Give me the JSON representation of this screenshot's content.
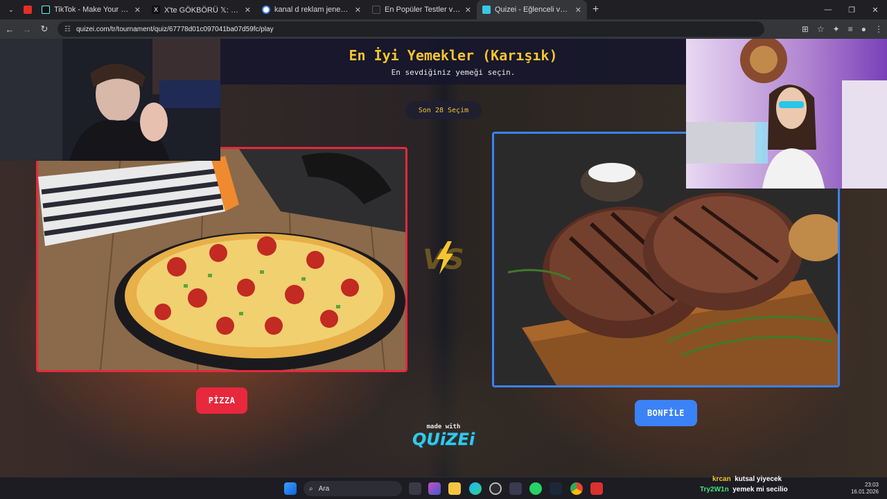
{
  "browser": {
    "tabs": [
      {
        "title": "",
        "favicon_color": "#e52d27"
      },
      {
        "title": "TikTok - Make Your Day",
        "favicon_color": "#111111"
      },
      {
        "title": "X'te GÖKBÖRÜ 𝕏: \"TÜRKİYE TÜ",
        "favicon_color": "#111111"
      },
      {
        "title": "kanal d reklam jeneriği - Google",
        "favicon_color": "#4285f4"
      },
      {
        "title": "En Popüler Testler ve Eğlenceli",
        "favicon_color": "#222222"
      },
      {
        "title": "Quizei - Eğlenceli ve etkileşimli",
        "favicon_color": "#38c7e8"
      }
    ],
    "url": "quizei.com/tr/tournament/quiz/67778d01c097041ba07d59fc/play"
  },
  "quiz": {
    "title": "En İyi Yemekler (Karışık)",
    "subtitle": "En sevdiğiniz yemeği seçin.",
    "round_label": "Son 28 Seçim",
    "left_choice": "PİZZA",
    "right_choice": "BONFİLE",
    "made_with": "made with",
    "brand": "QUiZEi",
    "left_color": "#e7283d",
    "right_color": "#3b82f6"
  },
  "taskbar": {
    "search_label": "Ara",
    "time": "23:03",
    "date": "16.01.2026"
  },
  "chat": [
    {
      "user": "krcan",
      "message": "kutsal yiyecek"
    },
    {
      "user": "Try2W1n",
      "message": "yemek mi secilio"
    }
  ]
}
